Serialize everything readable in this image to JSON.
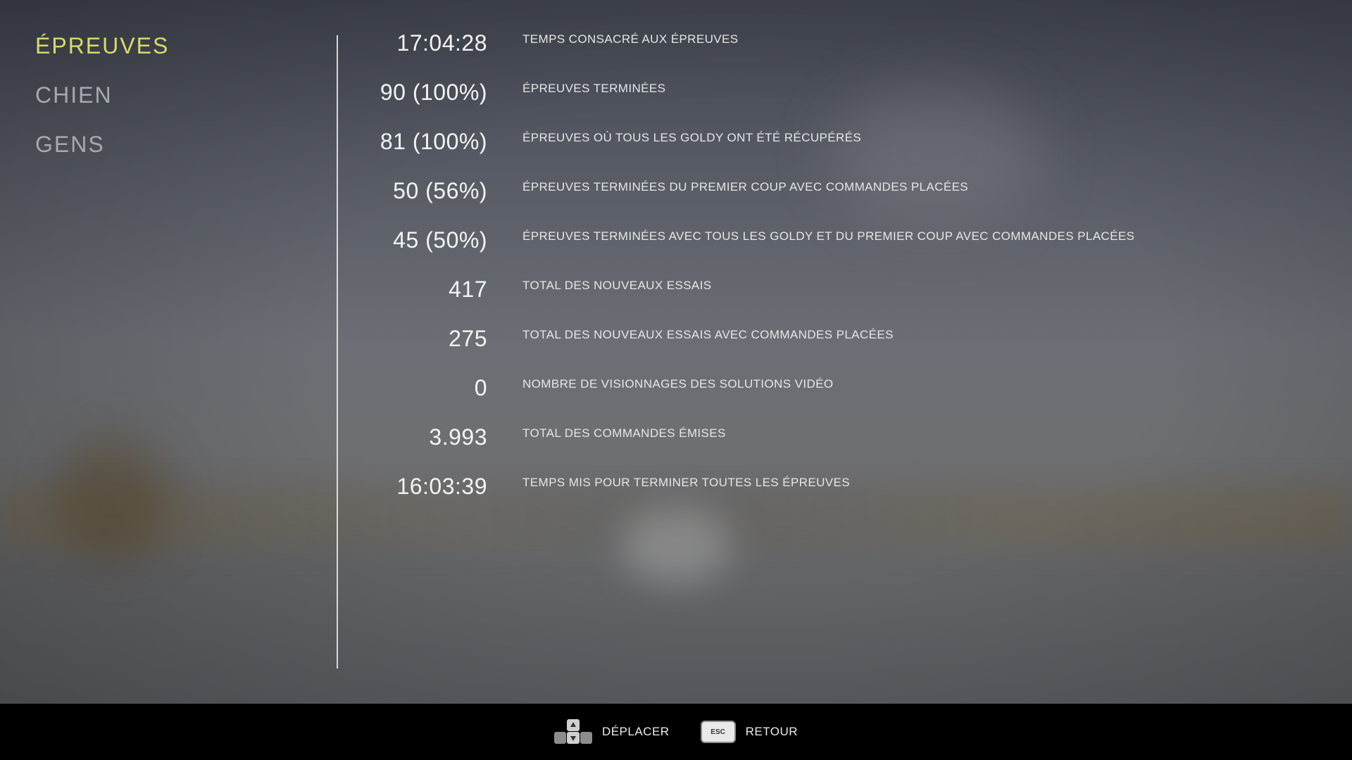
{
  "nav": {
    "items": [
      {
        "label": "ÉPREUVES",
        "active": true
      },
      {
        "label": "CHIEN",
        "active": false
      },
      {
        "label": "GENS",
        "active": false
      }
    ]
  },
  "stats": [
    {
      "value": "17:04:28",
      "label": "TEMPS CONSACRÉ AUX ÉPREUVES"
    },
    {
      "value": "90 (100%)",
      "label": "ÉPREUVES TERMINÉES"
    },
    {
      "value": "81 (100%)",
      "label": "ÉPREUVES OÙ TOUS LES GOLDY ONT ÉTÉ RÉCUPÉRÉS"
    },
    {
      "value": "50 (56%)",
      "label": "ÉPREUVES TERMINÉES DU PREMIER COUP AVEC COMMANDES PLACÉES"
    },
    {
      "value": "45 (50%)",
      "label": "ÉPREUVES TERMINÉES AVEC TOUS LES GOLDY ET DU PREMIER COUP AVEC COMMANDES PLACÉES"
    },
    {
      "value": "417",
      "label": "TOTAL DES NOUVEAUX ESSAIS"
    },
    {
      "value": "275",
      "label": "TOTAL DES NOUVEAUX ESSAIS AVEC COMMANDES PLACÉES"
    },
    {
      "value": "0",
      "label": "NOMBRE DE VISIONNAGES DES SOLUTIONS VIDÉO"
    },
    {
      "value": "3.993",
      "label": "TOTAL DES COMMANDES ÉMISES"
    },
    {
      "value": "16:03:39",
      "label": "TEMPS MIS POUR TERMINER TOUTES LES ÉPREUVES"
    }
  ],
  "footer": {
    "move": {
      "icon": "dpad-up-down-icon",
      "label": "DÉPLACER"
    },
    "back": {
      "icon": "esc-key-icon",
      "key_text": "ESC",
      "label": "RETOUR"
    }
  },
  "colors": {
    "active_nav": "#d8da6c",
    "inactive_nav": "#a7a9ad",
    "footer_bg": "#000000"
  }
}
